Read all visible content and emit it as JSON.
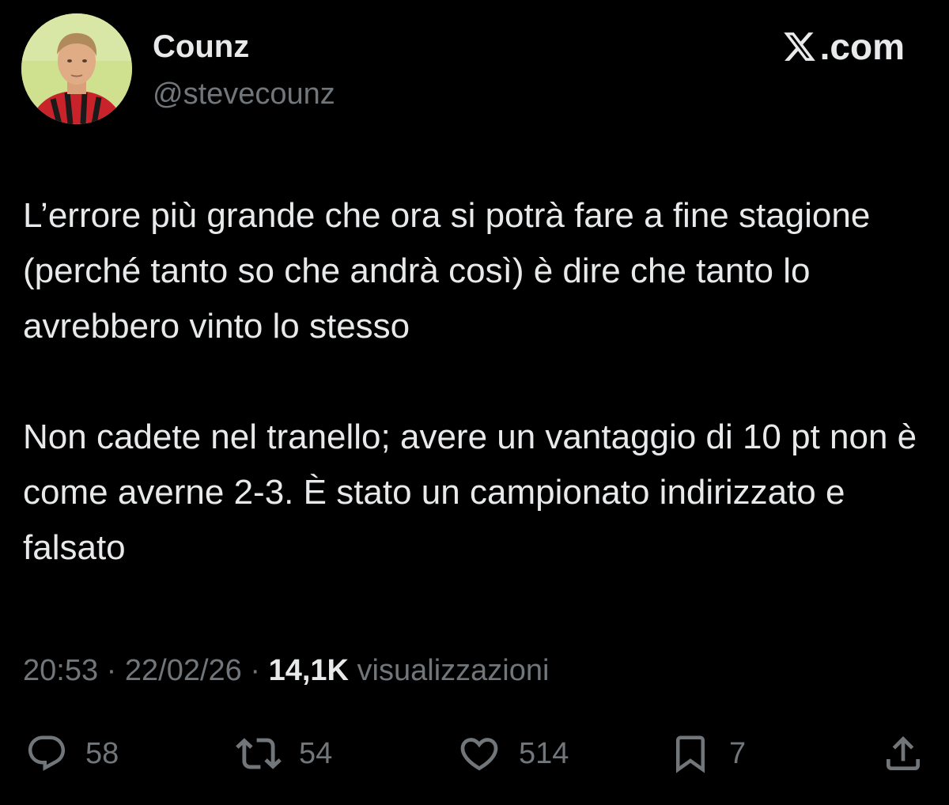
{
  "author": {
    "display_name": "Counz",
    "handle": "@stevecounz"
  },
  "brand": {
    "label": ".com",
    "icon": "x-logo-icon"
  },
  "tweet": {
    "paragraphs": [
      "L’errore più grande che ora si potrà fare a fine stagione (perché tanto so che andrà così) è dire che tanto lo avrebbero vinto lo stesso",
      "Non cadete nel tranello; avere un vantaggio di 10 pt non è come averne 2-3. È stato un campionato indirizzato e falsato"
    ]
  },
  "meta": {
    "time": "20:53",
    "separator": " · ",
    "date": "22/02/26",
    "views_count": "14,1K",
    "views_label": " visualizzazioni"
  },
  "actions": {
    "reply": {
      "icon": "reply-icon",
      "count": "58"
    },
    "repost": {
      "icon": "repost-icon",
      "count": "54"
    },
    "like": {
      "icon": "heart-icon",
      "count": "514"
    },
    "bookmark": {
      "icon": "bookmark-icon",
      "count": "7"
    },
    "share": {
      "icon": "share-icon"
    }
  },
  "colors": {
    "background": "#000000",
    "primary_text": "#e7e9ea",
    "secondary_text": "#71767b"
  }
}
